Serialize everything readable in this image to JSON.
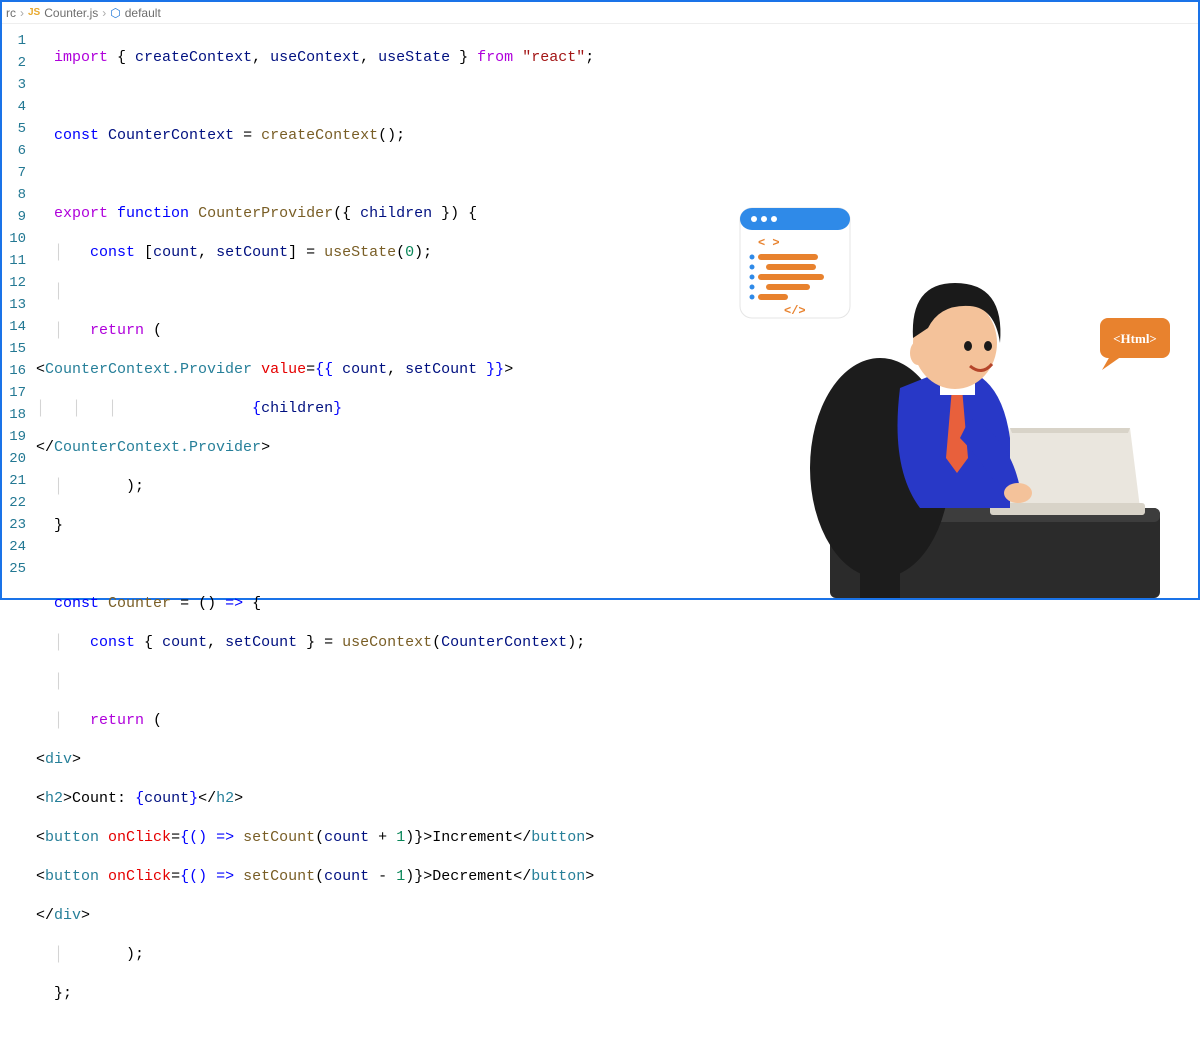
{
  "breadcrumb": {
    "folder": "rc",
    "file_badge": "JS",
    "file": "Counter.js",
    "symbol_icon": "⬡",
    "symbol": "default"
  },
  "line_numbers": [
    "1",
    "2",
    "3",
    "4",
    "5",
    "6",
    "7",
    "8",
    "9",
    "10",
    "11",
    "12",
    "13",
    "14",
    "15",
    "16",
    "17",
    "18",
    "19",
    "20",
    "21",
    "22",
    "23",
    "24",
    "25"
  ],
  "code": {
    "l1": {
      "a": "import",
      "b": " { ",
      "c": "createContext",
      "d": ", ",
      "e": "useContext",
      "f": ", ",
      "g": "useState",
      "h": " } ",
      "i": "from",
      "j": " ",
      "k": "\"react\"",
      "l": ";"
    },
    "l3": {
      "a": "const",
      "b": " ",
      "c": "CounterContext",
      "d": " = ",
      "e": "createContext",
      "f": "();"
    },
    "l5": {
      "a": "export",
      "b": " ",
      "c": "function",
      "d": " ",
      "e": "CounterProvider",
      "f": "({ ",
      "g": "children",
      "h": " }) {"
    },
    "l6": {
      "a": "    ",
      "b": "const",
      "c": " [",
      "d": "count",
      "e": ", ",
      "f": "setCount",
      "g": "] = ",
      "h": "useState",
      "i": "(",
      "j": "0",
      "k": ");"
    },
    "l8": {
      "a": "    ",
      "b": "return",
      "c": " ("
    },
    "l9": {
      "a": "<",
      "b": "CounterContext.Provider",
      "c": " ",
      "d": "value",
      "e": "=",
      "f": "{{ ",
      "g": "count",
      "h": ", ",
      "i": "setCount",
      "j": " }}",
      "k": ">"
    },
    "l10": {
      "a": "            {",
      "b": "children",
      "c": "}"
    },
    "l11": {
      "a": "</",
      "b": "CounterContext.Provider",
      "c": ">"
    },
    "l12": {
      "a": "    );"
    },
    "l13": {
      "a": "}"
    },
    "l15": {
      "a": "const",
      "b": " ",
      "c": "Counter",
      "d": " = () ",
      "e": "=>",
      "f": " {"
    },
    "l16": {
      "a": "    ",
      "b": "const",
      "c": " { ",
      "d": "count",
      "e": ", ",
      "f": "setCount",
      "g": " } = ",
      "h": "useContext",
      "i": "(",
      "j": "CounterContext",
      "k": ");"
    },
    "l18": {
      "a": "    ",
      "b": "return",
      "c": " ("
    },
    "l19": {
      "a": "<",
      "b": "div",
      "c": ">"
    },
    "l20": {
      "a": "<",
      "b": "h2",
      "c": ">",
      "d": "Count: ",
      "e": "{",
      "f": "count",
      "g": "}",
      "h": "</",
      "i": "h2",
      "j": ">"
    },
    "l21": {
      "a": "<",
      "b": "button",
      "c": " ",
      "d": "onClick",
      "e": "=",
      "f": "{() ",
      "g": "=>",
      "h": " ",
      "i": "setCount",
      "j": "(",
      "k": "count",
      "l": " + ",
      "m": "1",
      "n": ")}>",
      "o": "Increment",
      "p": "</",
      "q": "button",
      "r": ">"
    },
    "l22": {
      "a": "<",
      "b": "button",
      "c": " ",
      "d": "onClick",
      "e": "=",
      "f": "{() ",
      "g": "=>",
      "h": " ",
      "i": "setCount",
      "j": "(",
      "k": "count",
      "l": " - ",
      "m": "1",
      "n": ")}>",
      "o": "Decrement",
      "p": "</",
      "q": "button",
      "r": ">"
    },
    "l23": {
      "a": "</",
      "b": "div",
      "c": ">"
    },
    "l24": {
      "a": "    );"
    },
    "l25": {
      "a": "};"
    }
  },
  "illustration": {
    "html_bubble": "<Html>",
    "code_bubble": "< >"
  }
}
